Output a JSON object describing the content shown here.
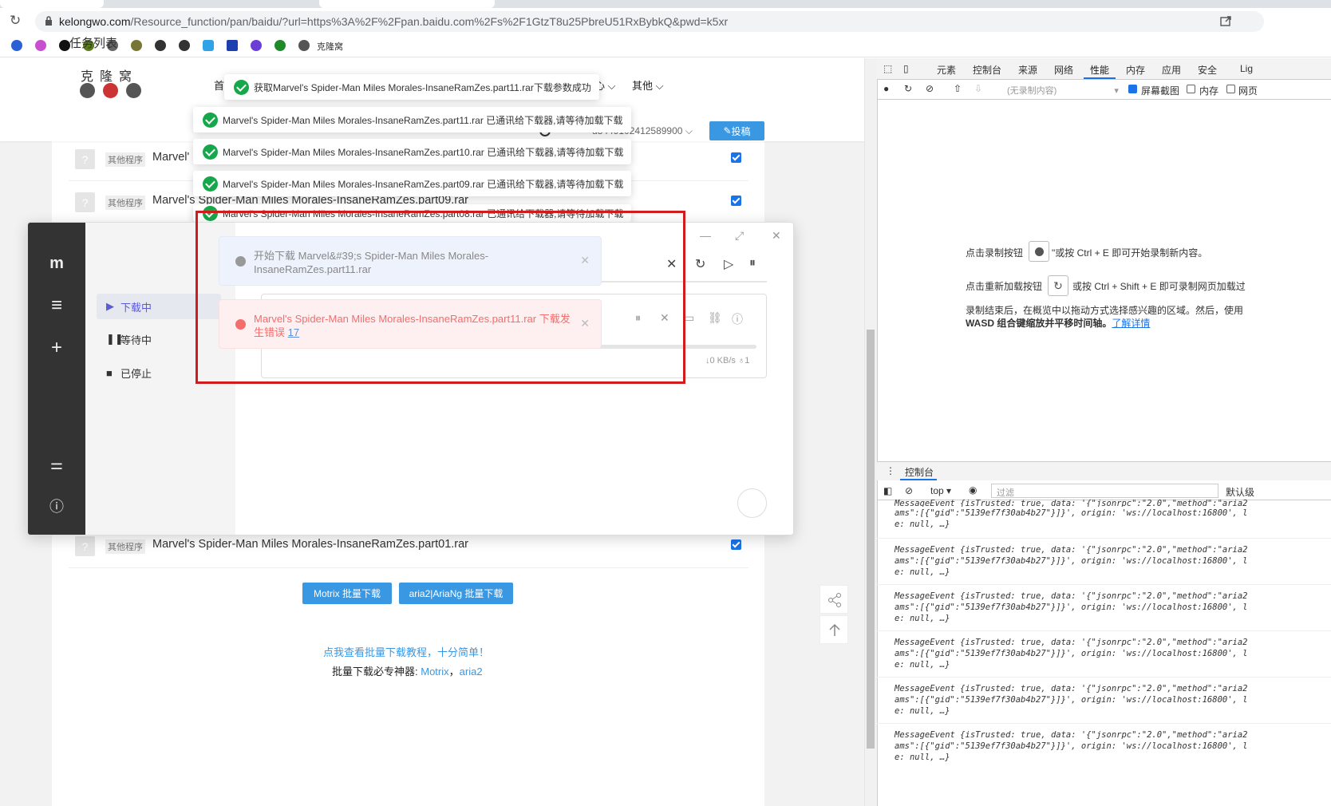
{
  "browser": {
    "url_host": "kelongwo.com",
    "url_rest": "/Resource_function/pan/baidu/?url=https%3A%2F%2Fpan.baidu.com%2Fs%2F1GtzT8u25PbreU51RxBybkQ&pwd=k5xr",
    "bookmark_label": "克隆窝"
  },
  "site": {
    "logo": "克隆窝",
    "nav_first": "首",
    "nav_center": "心",
    "nav_other": "其他",
    "user_id": "u8449102412589900",
    "post_button": "投稿",
    "rows": [
      {
        "tag": "其他程序",
        "name": "Marvel'"
      },
      {
        "tag": "其他程序",
        "name": "Marvel's Spider-Man Miles Morales-InsaneRamZes.part09.rar"
      },
      {
        "tag": "其他程序",
        "name": "Marvel's Spider-Man Miles Morales-InsaneRamZes.part01.rar"
      }
    ],
    "motrix_batch": "Motrix 批量下载",
    "aria_batch": "aria2|AriaNg 批量下载",
    "tutorial": "点我查看批量下载教程，十分简单！",
    "must_label": "批量下载必专神器:",
    "must_motrix": "Motrix",
    "must_sep": "，",
    "must_aria": "aria2"
  },
  "toasts": [
    "获取Marvel's Spider-Man Miles Morales-InsaneRamZes.part11.rar下载参数成功",
    "Marvel's Spider-Man Miles Morales-InsaneRamZes.part11.rar 已通讯给下载器,请等待加载下载",
    "Marvel's Spider-Man Miles Morales-InsaneRamZes.part10.rar 已通讯给下载器,请等待加载下载",
    "Marvel's Spider-Man Miles Morales-InsaneRamZes.part09.rar 已通讯给下载器,请等待加载下载",
    "Marvel's Spider-Man Miles Morales-InsaneRamZes.part08.rar 已通讯给下载器,请等待加载下载"
  ],
  "motrix": {
    "title": "任务列表",
    "items": [
      "下载中",
      "等待中",
      "已停止"
    ],
    "speed": "↓0 KB/s  ♁1",
    "notice_info": "开始下载 Marvel&#39;s Spider-Man Miles Morales-InsaneRamZes.part11.rar",
    "notice_error_text": "Marvel's Spider-Man Miles Morales-InsaneRamZes.part11.rar 下载发生错误",
    "notice_error_code": "17"
  },
  "devtools": {
    "tabs": [
      "元素",
      "控制台",
      "来源",
      "网络",
      "性能",
      "内存",
      "应用",
      "安全",
      "Lig"
    ],
    "no_recording": "(无录制内容)",
    "screenshot_label": "屏幕截图",
    "memory_label": "内存",
    "web_label": "网页",
    "hint1_a": "点击录制按钮",
    "hint1_b": "\"或按 Ctrl + E 即可开始录制新内容。",
    "hint2_a": "点击重新加载按钮",
    "hint2_b": "或按 Ctrl + Shift + E 即可录制网页加载过",
    "hint3": "录制结束后，在概览中以拖动方式选择感兴趣的区域。然后，使用",
    "hint4_a": "WASD 组合键缩放并平移时间轴。",
    "hint4_link": "了解详情",
    "drawer_tab": "控制台",
    "context": "top",
    "filter_placeholder": "过滤",
    "level": "默认级",
    "log_line1": "MessageEvent {isTrusted: true, data: '{\"jsonrpc\":\"2.0\",\"method\":\"aria2",
    "log_line2": "ams\":[{\"gid\":\"5139ef7f30ab4b27\"}]}', origin: 'ws://localhost:16800', l",
    "log_line3": "e: null, …}",
    "top_line": "MessageEvent {isTrusted: true, data: '{\"jsonrpc\":\"2.0\",\"method\":\"aria2"
  }
}
